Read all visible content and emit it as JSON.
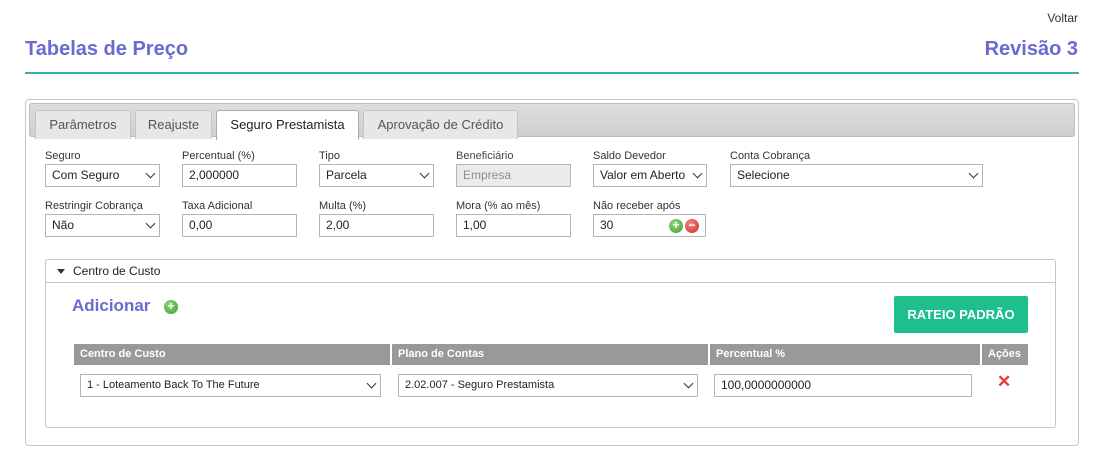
{
  "header": {
    "back_label": "Voltar",
    "title": "Tabelas de Preço",
    "revision": "Revisão 3"
  },
  "tabs": [
    {
      "label": "Parâmetros",
      "active": false
    },
    {
      "label": "Reajuste",
      "active": false
    },
    {
      "label": "Seguro Prestamista",
      "active": true
    },
    {
      "label": "Aprovação de Crédito",
      "active": false
    }
  ],
  "form": {
    "seguro": {
      "label": "Seguro",
      "value": "Com Seguro"
    },
    "percentual": {
      "label": "Percentual (%)",
      "value": "2,000000"
    },
    "tipo": {
      "label": "Tipo",
      "value": "Parcela"
    },
    "beneficiario": {
      "label": "Beneficiário",
      "placeholder": "Empresa"
    },
    "saldo_devedor": {
      "label": "Saldo Devedor",
      "value": "Valor em Aberto"
    },
    "conta_cobranca": {
      "label": "Conta Cobrança",
      "value": "Selecione"
    },
    "restringir": {
      "label": "Restringir Cobrança",
      "value": "Não"
    },
    "taxa_adicional": {
      "label": "Taxa Adicional",
      "value": "0,00"
    },
    "multa": {
      "label": "Multa (%)",
      "value": "2,00"
    },
    "mora": {
      "label": "Mora (% ao mês)",
      "value": "1,00"
    },
    "nao_receber": {
      "label": "Não receber após",
      "value": "30"
    }
  },
  "centro_custo": {
    "section_title": "Centro de Custo",
    "add_label": "Adicionar",
    "rateio_label": "RATEIO PADRÃO",
    "columns": [
      "Centro de Custo",
      "Plano de Contas",
      "Percentual %",
      "Ações"
    ],
    "rows": [
      {
        "centro": "1 - Loteamento Back To The Future",
        "plano": "2.02.007 - Seguro Prestamista",
        "percentual": "100,0000000000"
      }
    ]
  },
  "colors": {
    "accent": "#6a6ad3",
    "rule": "#2fb5a5",
    "button": "#1dbf8c",
    "delete": "#e53935"
  }
}
